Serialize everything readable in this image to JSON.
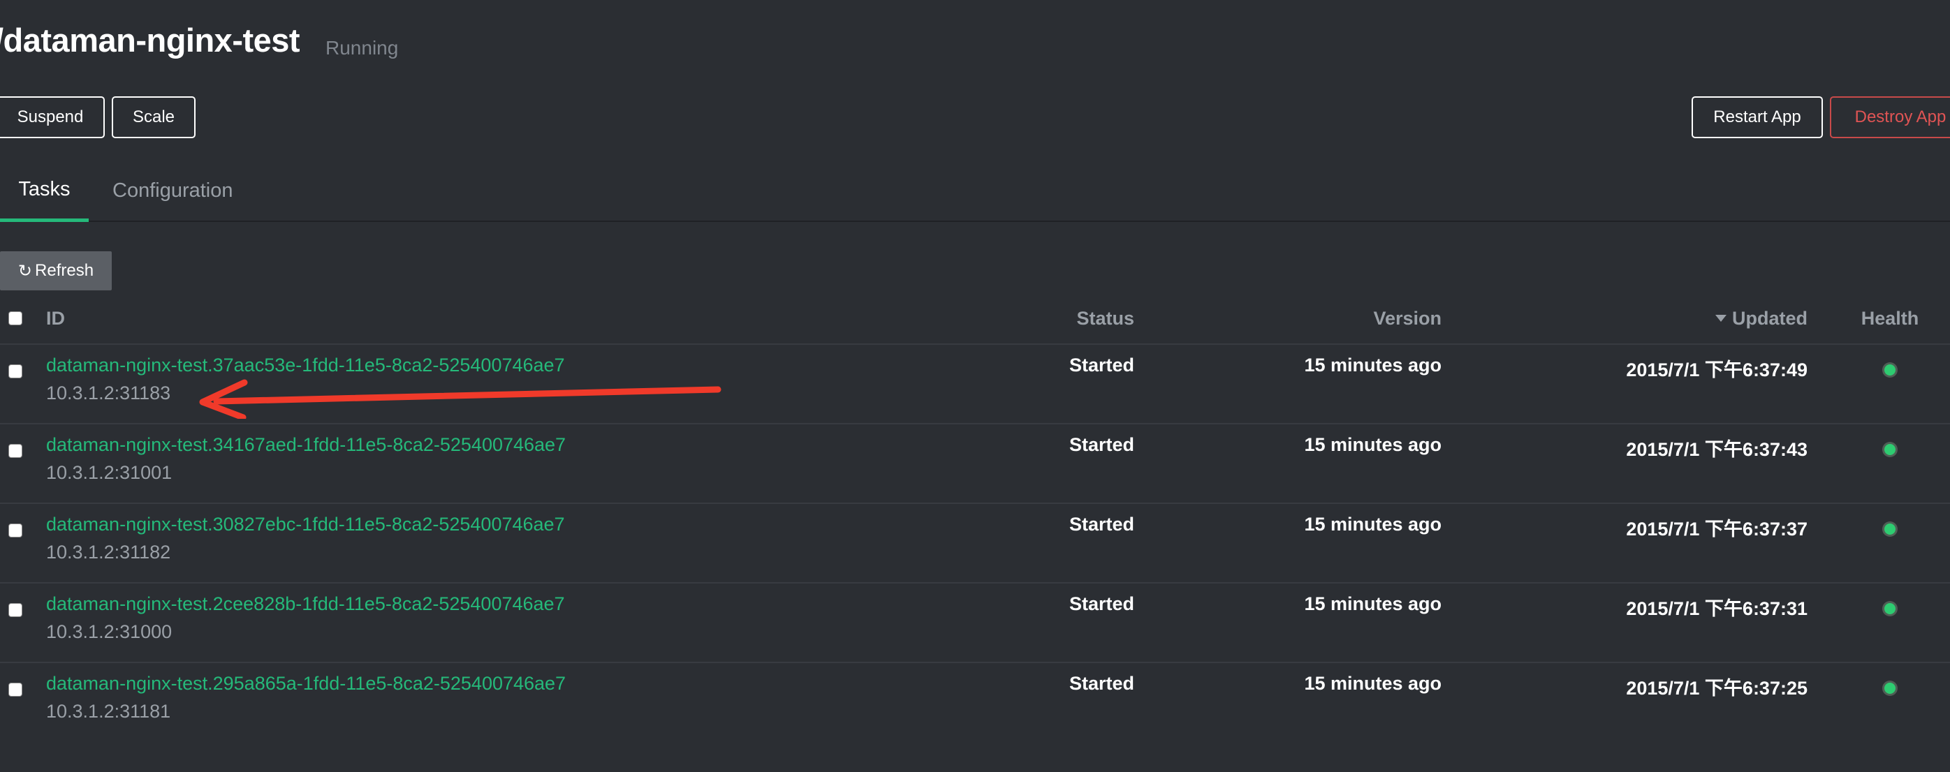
{
  "header": {
    "app_name": "/dataman-nginx-test",
    "status": "Running"
  },
  "actions": {
    "suspend": "Suspend",
    "scale": "Scale",
    "restart": "Restart App",
    "destroy": "Destroy App"
  },
  "tabs": [
    {
      "label": "Tasks",
      "active": true
    },
    {
      "label": "Configuration",
      "active": false
    }
  ],
  "refresh_label": "Refresh",
  "table": {
    "columns": {
      "id": "ID",
      "status": "Status",
      "version": "Version",
      "updated": "Updated",
      "health": "Health"
    },
    "sort": {
      "column": "Updated",
      "direction": "desc"
    },
    "rows": [
      {
        "id": "dataman-nginx-test.37aac53e-1fdd-11e5-8ca2-525400746ae7",
        "host": "10.3.1.2:31183",
        "status": "Started",
        "version": "15 minutes ago",
        "updated": "2015/7/1 下午6:37:49",
        "health": "healthy"
      },
      {
        "id": "dataman-nginx-test.34167aed-1fdd-11e5-8ca2-525400746ae7",
        "host": "10.3.1.2:31001",
        "status": "Started",
        "version": "15 minutes ago",
        "updated": "2015/7/1 下午6:37:43",
        "health": "healthy"
      },
      {
        "id": "dataman-nginx-test.30827ebc-1fdd-11e5-8ca2-525400746ae7",
        "host": "10.3.1.2:31182",
        "status": "Started",
        "version": "15 minutes ago",
        "updated": "2015/7/1 下午6:37:37",
        "health": "healthy"
      },
      {
        "id": "dataman-nginx-test.2cee828b-1fdd-11e5-8ca2-525400746ae7",
        "host": "10.3.1.2:31000",
        "status": "Started",
        "version": "15 minutes ago",
        "updated": "2015/7/1 下午6:37:31",
        "health": "healthy"
      },
      {
        "id": "dataman-nginx-test.295a865a-1fdd-11e5-8ca2-525400746ae7",
        "host": "10.3.1.2:31181",
        "status": "Started",
        "version": "15 minutes ago",
        "updated": "2015/7/1 下午6:37:25",
        "health": "healthy"
      }
    ]
  },
  "icons": {
    "refresh": "refresh-icon",
    "sort": "caret-down-icon",
    "health": "health-dot-icon",
    "annotation": "red-arrow-icon"
  },
  "colors": {
    "background": "#2b2e33",
    "accent": "#25b97a",
    "danger": "#e05454",
    "healthy": "#2ecc71",
    "annotation": "#f03a2a"
  }
}
